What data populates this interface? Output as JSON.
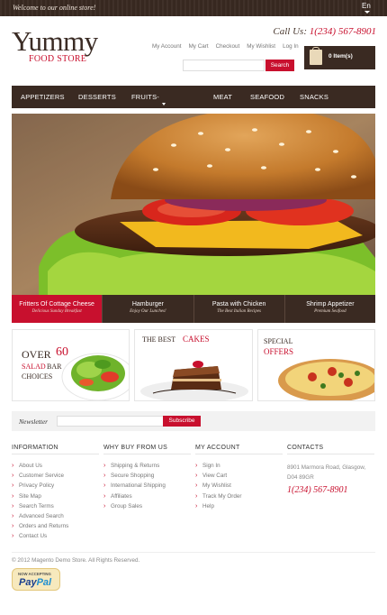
{
  "topbar": {
    "welcome": "Welcome to our online store!",
    "language": "En"
  },
  "header": {
    "logo_main": "Yummy",
    "logo_sub": "FOOD STORE",
    "call_label": "Call Us:",
    "phone": "1(234) 567-8901",
    "links": [
      "My Account",
      "My Cart",
      "Checkout",
      "My Wishlist",
      "Log In"
    ],
    "search_placeholder": "",
    "search_label": "Search",
    "cart_label": "0 Item(s)"
  },
  "nav": {
    "items": [
      "APPETIZERS",
      "DESSERTS",
      "FRUITS-VEGETABLE",
      "MEAT",
      "SEAFOOD",
      "SNACKS"
    ],
    "active_index": 2
  },
  "slider": {
    "tabs": [
      {
        "title": "Fritters Of Cottage Cheese",
        "subtitle": "Delicious Sunday Breakfast"
      },
      {
        "title": "Hamburger",
        "subtitle": "Enjoy Our Lunches!"
      },
      {
        "title": "Pasta with Chicken",
        "subtitle": "The Best Italian Recipes"
      },
      {
        "title": "Shrimp Appetizer",
        "subtitle": "Premium Seafood"
      }
    ],
    "active_index": 0
  },
  "banners": {
    "b1": {
      "over": "OVER",
      "num": "60",
      "salad": "SALAD",
      "bar": "BAR",
      "choices": "CHOICES"
    },
    "b2": {
      "the_best": "THE BEST",
      "cakes": "CAKES"
    },
    "b3": {
      "special": "SPECIAL",
      "offers": "OFFERS"
    }
  },
  "newsletter": {
    "label": "Newsletter",
    "button": "Subscribe",
    "placeholder": ""
  },
  "footer": {
    "information": {
      "title": "INFORMATION",
      "links": [
        "About Us",
        "Customer Service",
        "Privacy Policy",
        "Site Map",
        "Search Terms",
        "Advanced Search",
        "Orders and Returns",
        "Contact Us"
      ]
    },
    "why": {
      "title": "WHY BUY FROM US",
      "links": [
        "Shipping & Returns",
        "Secure Shopping",
        "International Shipping",
        "Affiliates",
        "Group Sales"
      ]
    },
    "account": {
      "title": "MY ACCOUNT",
      "links": [
        "Sign In",
        "View Cart",
        "My Wishlist",
        "Track My Order",
        "Help"
      ]
    },
    "contacts": {
      "title": "CONTACTS",
      "address": "8901 Marmora Road, Glasgow, D04 89GR",
      "phone": "1(234) 567-8901"
    },
    "copyright": "© 2012 Magento Demo Store. All Rights Reserved.",
    "paypal_top": "NOW ACCEPTING",
    "paypal_a": "Pay",
    "paypal_b": "Pal"
  },
  "colors": {
    "brand_dark": "#3a2a22",
    "accent_red": "#c8102e"
  }
}
